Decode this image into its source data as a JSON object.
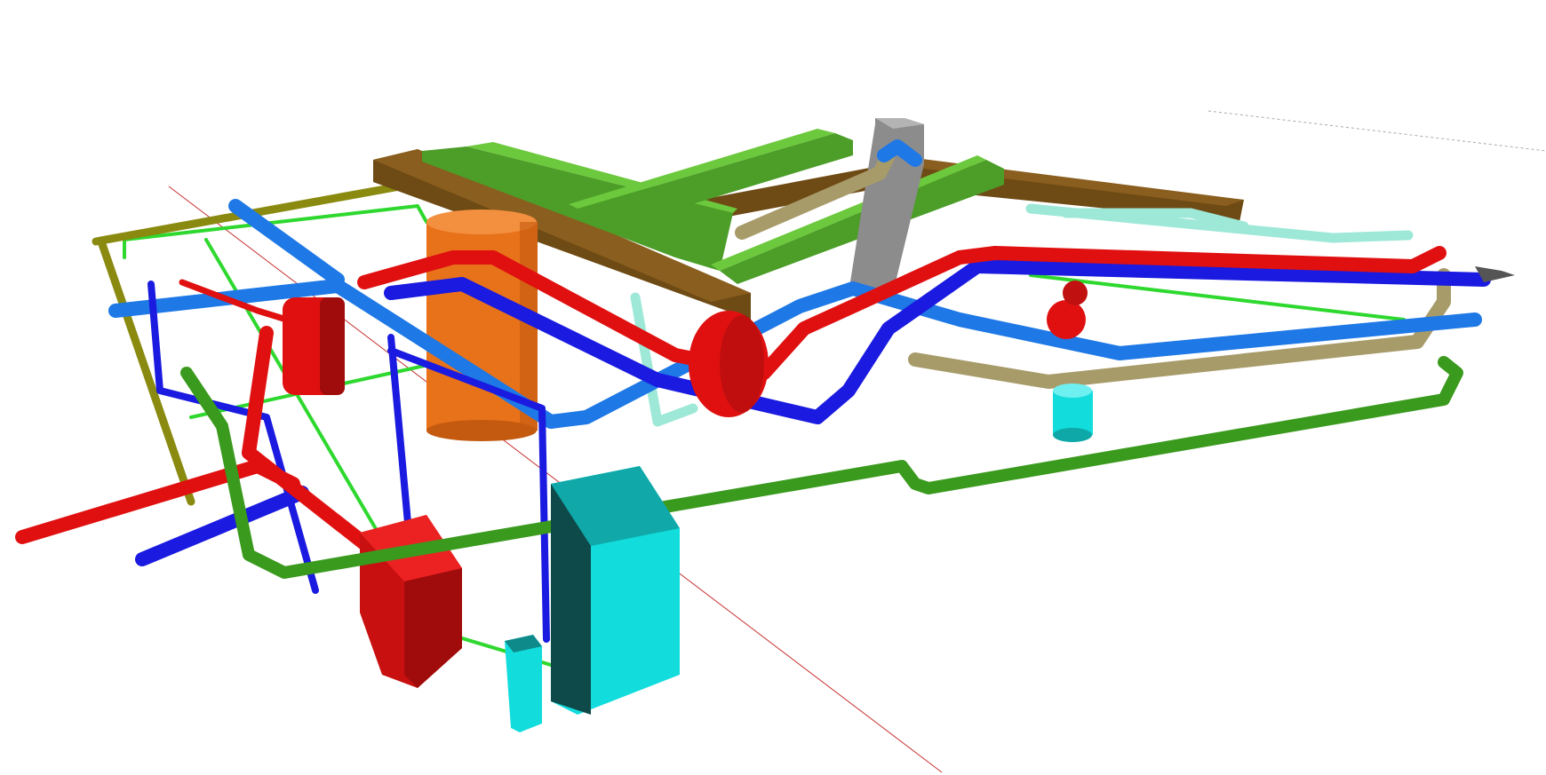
{
  "scene": {
    "kind": "3d-piping-model",
    "background": "#ffffff",
    "colors": {
      "supply_red": "#e01010",
      "return_blue": "#1a1ae0",
      "light_blue": "#1e78e6",
      "green": "#3a9a1e",
      "bright_green": "#2ed82e",
      "olive": "#8a8a10",
      "khaki": "#a89b6a",
      "aqua": "#9ee8d8",
      "orange": "#e8721a",
      "cyan": "#12dcdc",
      "brown": "#7a5418",
      "duct_green": "#5cb830",
      "grey": "#8c8c8c",
      "magenta": "#e040c0",
      "axis_red": "#c83030"
    },
    "components": [
      {
        "name": "orange-storage-tank"
      },
      {
        "name": "red-boiler"
      },
      {
        "name": "red-expansion-vessel"
      },
      {
        "name": "red-pump-vessel"
      },
      {
        "name": "cyan-cabinet"
      },
      {
        "name": "cyan-small-cabinet"
      },
      {
        "name": "cyan-cylinder"
      },
      {
        "name": "grey-column"
      },
      {
        "name": "brown-duct"
      },
      {
        "name": "green-duct"
      }
    ]
  }
}
